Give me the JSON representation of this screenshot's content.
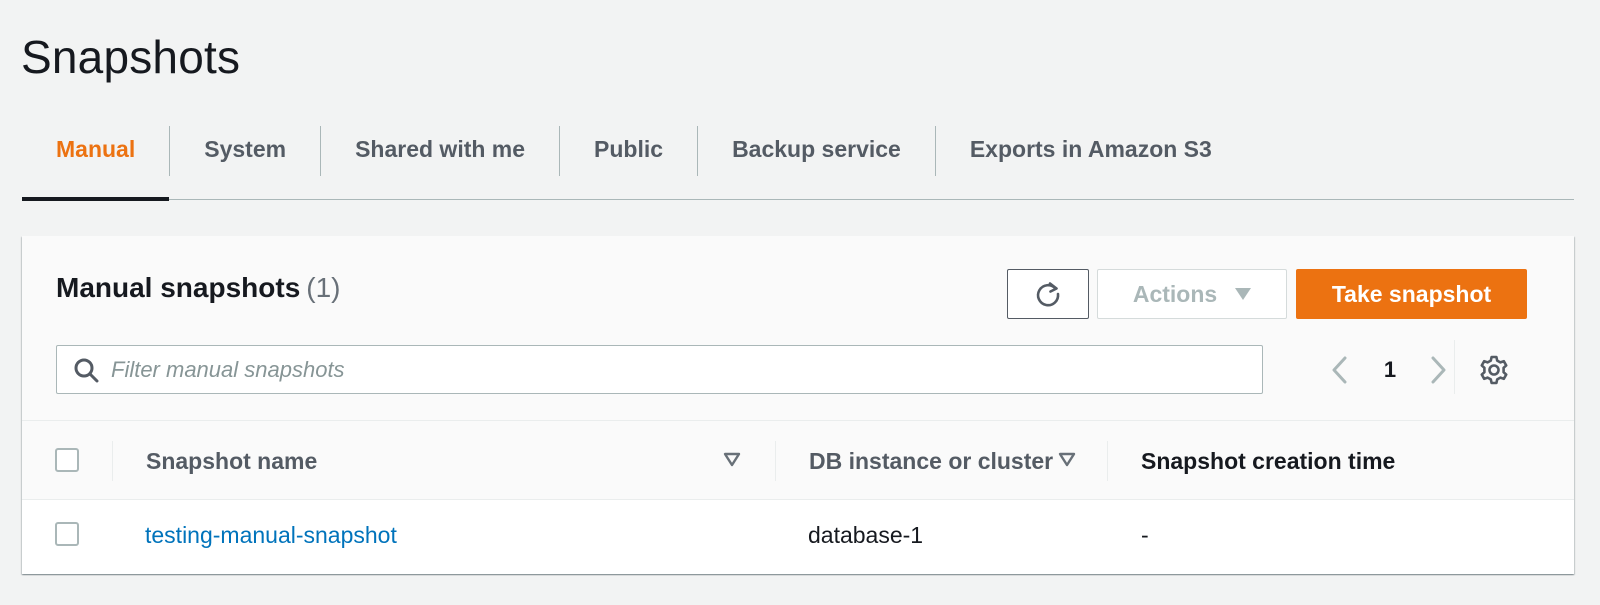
{
  "page": {
    "title": "Snapshots"
  },
  "tabs": [
    {
      "label": "Manual",
      "active": true
    },
    {
      "label": "System",
      "active": false
    },
    {
      "label": "Shared with me",
      "active": false
    },
    {
      "label": "Public",
      "active": false
    },
    {
      "label": "Backup service",
      "active": false
    },
    {
      "label": "Exports in Amazon S3",
      "active": false
    }
  ],
  "panel": {
    "title": "Manual snapshots",
    "count": "(1)",
    "actions_label": "Actions",
    "take_snapshot_label": "Take snapshot",
    "filter_placeholder": "Filter manual snapshots",
    "filter_value": "",
    "page_number": "1"
  },
  "table": {
    "columns": [
      {
        "label": "Snapshot name",
        "sortable": true
      },
      {
        "label": "DB instance or cluster",
        "sortable": true
      },
      {
        "label": "Snapshot creation time",
        "sortable": false
      }
    ],
    "rows": [
      {
        "snapshot_name": "testing-manual-snapshot",
        "db_instance": "database-1",
        "creation_time": "-"
      }
    ]
  },
  "colors": {
    "accent": "#ec7211",
    "link": "#0073bb",
    "text": "#16191f",
    "muted": "#545b64",
    "border": "#aab7b8",
    "background": "#f2f3f3"
  },
  "icons": {
    "refresh": "refresh-icon",
    "actions_caret": "caret-down-icon",
    "search": "search-icon",
    "prev": "chevron-left-icon",
    "next": "chevron-right-icon",
    "settings": "gear-icon",
    "sort": "sort-down-icon"
  }
}
